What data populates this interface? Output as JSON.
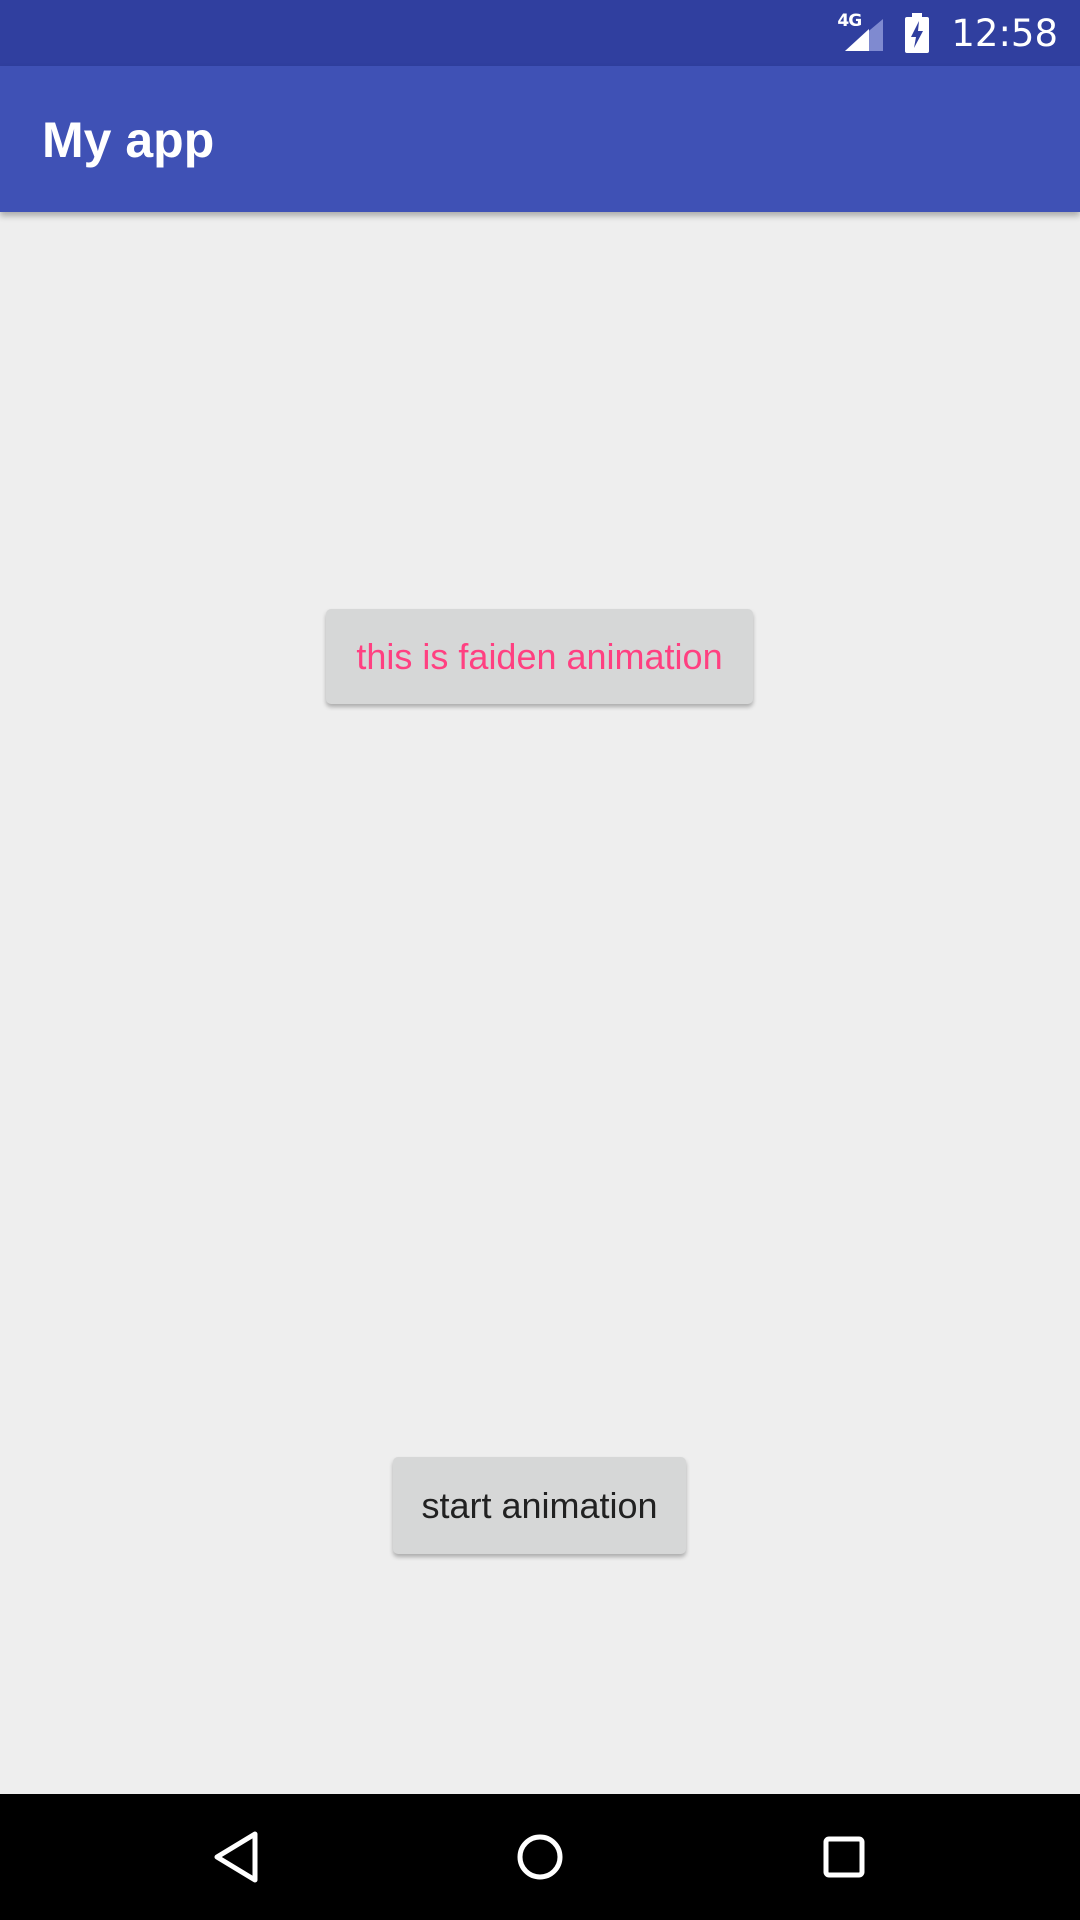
{
  "status_bar": {
    "network_label": "4G",
    "time": "12:58",
    "icons": [
      "signal-icon",
      "battery-charging-icon"
    ]
  },
  "app_bar": {
    "title": "My app"
  },
  "main": {
    "fade_button_label": "this is faiden animation",
    "start_button_label": "start animation"
  },
  "nav_bar": {
    "icons": [
      "back-icon",
      "home-icon",
      "recents-icon"
    ]
  },
  "colors": {
    "status_bar": "#303f9f",
    "app_bar": "#3f51b5",
    "background": "#eeeeee",
    "accent": "#ff4081",
    "button": "#d6d7d7"
  }
}
